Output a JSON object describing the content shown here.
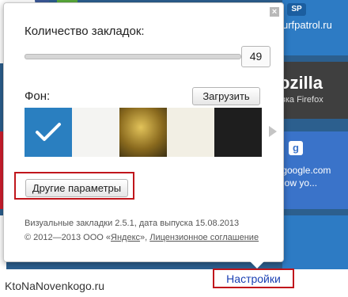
{
  "background_tiles": {
    "surf": {
      "badge": "SP",
      "text": "urfpatrol.ru"
    },
    "mozilla": {
      "title": "ozilla",
      "subtitle": "вка Firefox"
    },
    "google": {
      "badge": "g",
      "line1": ".google.com",
      "line2": "how yo..."
    }
  },
  "popup": {
    "close_icon_glyph": "×",
    "bookmarks_count_label": "Количество закладок:",
    "bookmarks_count_value": "49",
    "background_label": "Фон:",
    "upload_button": "Загрузить",
    "other_params_button": "Другие параметры",
    "version_text": "Визуальные закладки 2.5.1, дата выпуска 15.08.2013",
    "copyright_prefix": "© 2012—2013 ООО «",
    "copyright_company": "Яндекс",
    "copyright_mid": "», ",
    "copyright_license": "Лицензионное соглашение"
  },
  "bottom_bar": {
    "watermark": "KtoNaNovenkogo.ru",
    "settings_link": "Настройки"
  },
  "colors": {
    "highlight_outline": "#c0161c",
    "link_blue": "#1a3fb3",
    "selected_swatch": "#2a7fc0"
  }
}
